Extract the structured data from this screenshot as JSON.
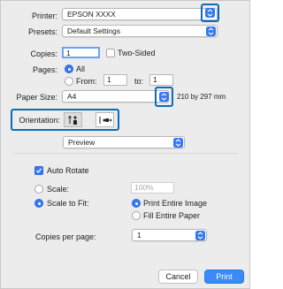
{
  "printer": {
    "label": "Printer:",
    "value": "EPSON XXXX"
  },
  "presets": {
    "label": "Presets:",
    "value": "Default Settings"
  },
  "copies": {
    "label": "Copies:",
    "value": "1",
    "two_sided_label": "Two-Sided"
  },
  "pages": {
    "label": "Pages:",
    "all_label": "All",
    "from_label": "From:",
    "from_value": "1",
    "to_label": "to:",
    "to_value": "1"
  },
  "paper_size": {
    "label": "Paper Size:",
    "value": "A4",
    "dimensions": "210 by 297 mm"
  },
  "orientation": {
    "label": "Orientation:"
  },
  "section_menu": {
    "value": "Preview"
  },
  "auto_rotate": {
    "label": "Auto Rotate",
    "checked": true
  },
  "scale": {
    "label": "Scale:",
    "value": "100%"
  },
  "scale_to_fit": {
    "label": "Scale to Fit:",
    "print_entire_image": "Print Entire Image",
    "fill_entire_paper": "Fill Entire Paper"
  },
  "copies_per_page": {
    "label": "Copies per page:",
    "value": "1"
  },
  "buttons": {
    "cancel": "Cancel",
    "print": "Print"
  },
  "colors": {
    "accent": "#3478f6",
    "highlight": "#0b6db8"
  },
  "icons": [
    "chevron-updown-icon",
    "portrait-icon",
    "landscape-icon",
    "checkmark-icon"
  ]
}
